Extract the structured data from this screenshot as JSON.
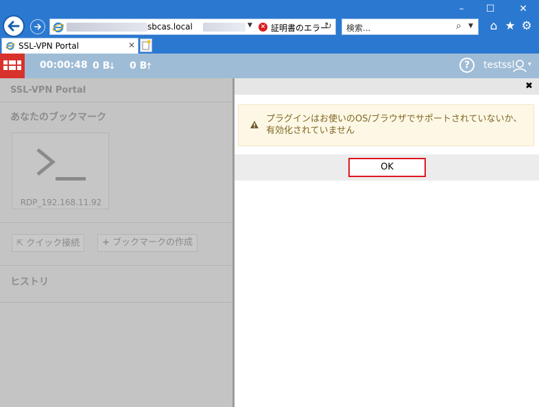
{
  "browser": {
    "address": {
      "host": "sbcas.local",
      "cert_error": "証明書のエラー"
    },
    "search_placeholder": "検索...",
    "tab_title": "SSL-VPN Portal",
    "icons": [
      "back-arrow-icon",
      "forward-arrow-icon",
      "ie-logo-icon",
      "refresh-icon",
      "search-icon",
      "home-icon",
      "favorites-star-icon",
      "settings-gear-icon",
      "new-tab-icon"
    ]
  },
  "header": {
    "timer": "00:00:48",
    "bytes_down": "0 B",
    "bytes_up": "0 B",
    "username": "testssl"
  },
  "sidebar": {
    "title": "SSL-VPN Portal",
    "bookmarks_heading": "あなたのブックマーク",
    "bookmark": {
      "label": "RDP_192.168.11.92",
      "icon": "terminal-icon"
    },
    "quick_connect_label": "クイック接続",
    "create_bookmark_label": "ブックマークの作成",
    "history_heading": "ヒストリ"
  },
  "dialog": {
    "message": "プラグインはお使いのOS/ブラウザでサポートされていないか、有効化されていません",
    "ok_label": "OK"
  },
  "colors": {
    "browser_chrome": "#2b78d0",
    "portal_header": "#9fbcd6",
    "forti_red": "#d8322c",
    "alert_bg": "#fdf8e6",
    "alert_text": "#7f6520",
    "ok_highlight": "#e0141e"
  }
}
